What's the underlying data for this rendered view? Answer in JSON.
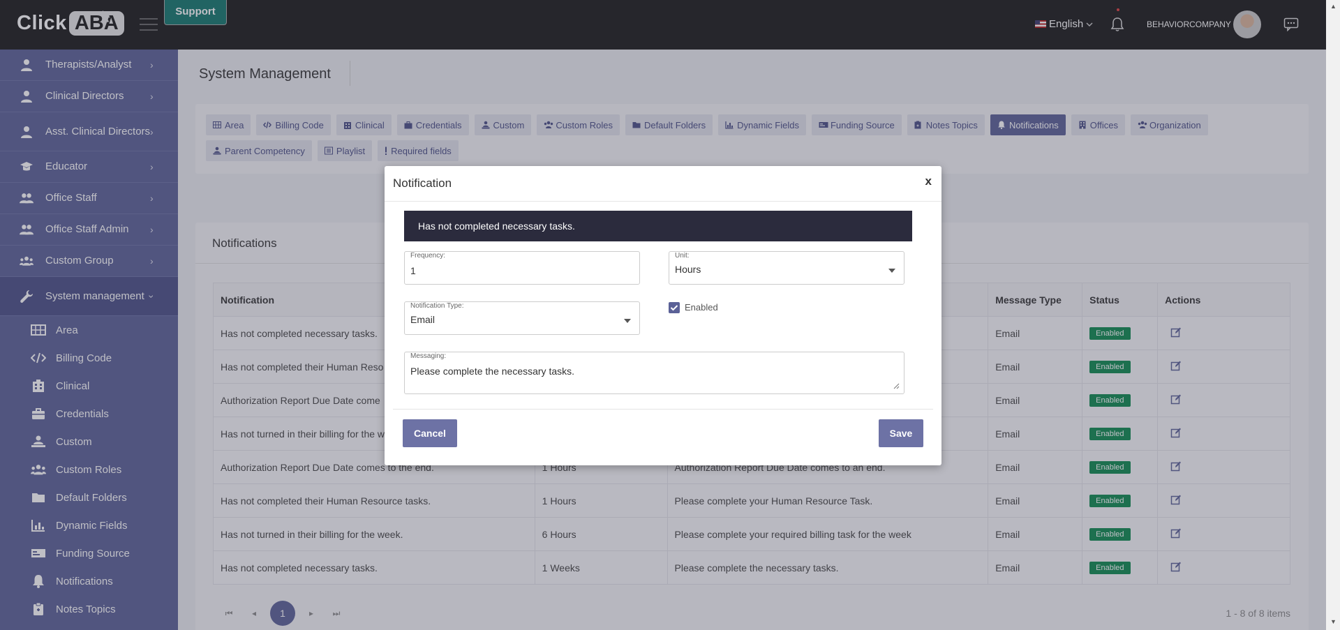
{
  "topbar": {
    "logo_click": "Click",
    "logo_aba": "ABA",
    "support_label": "Support",
    "language": "English",
    "company": "BEHAVIORCOMPANY"
  },
  "sidebar": {
    "items": [
      {
        "label": "Therapists/Analyst",
        "icon": "user-icon"
      },
      {
        "label": "Clinical Directors",
        "icon": "user-icon"
      },
      {
        "label": "Asst. Clinical Directors",
        "icon": "user-icon"
      },
      {
        "label": "Educator",
        "icon": "graduation-cap-icon"
      },
      {
        "label": "Office Staff",
        "icon": "users-icon"
      },
      {
        "label": "Office Staff Admin",
        "icon": "users-icon"
      },
      {
        "label": "Custom Group",
        "icon": "users-group-icon"
      },
      {
        "label": "System management",
        "icon": "wrench-icon"
      }
    ],
    "sub_items": [
      {
        "label": "Area",
        "icon": "map-icon"
      },
      {
        "label": "Billing Code",
        "icon": "code-icon"
      },
      {
        "label": "Clinical",
        "icon": "building-icon"
      },
      {
        "label": "Credentials",
        "icon": "briefcase-icon"
      },
      {
        "label": "Custom",
        "icon": "person-chalkboard-icon"
      },
      {
        "label": "Custom Roles",
        "icon": "users-group-icon"
      },
      {
        "label": "Default Folders",
        "icon": "folder-icon"
      },
      {
        "label": "Dynamic Fields",
        "icon": "chart-bar-icon"
      },
      {
        "label": "Funding Source",
        "icon": "money-bill-icon"
      },
      {
        "label": "Notifications",
        "icon": "bell-icon"
      },
      {
        "label": "Notes Topics",
        "icon": "clipboard-icon"
      }
    ]
  },
  "main": {
    "page_title": "System Management",
    "tabs_row1": [
      "Area",
      "Billing Code",
      "Clinical",
      "Credentials",
      "Custom",
      "Custom Roles",
      "Default Folders",
      "Dynamic Fields",
      "Funding Source",
      "Notes Topics",
      "Notifications",
      "Offices",
      "Organization"
    ],
    "tabs_row2": [
      "Parent Competency",
      "Playlist",
      "Required fields"
    ],
    "active_tab": "Notifications",
    "card_title": "Notifications",
    "columns": [
      "Notification",
      "",
      "",
      "Message Type",
      "Status",
      "Actions"
    ],
    "rows": [
      {
        "notification": "Has not completed necessary tasks.",
        "frequency": "",
        "message": "",
        "type": "Email",
        "status": "Enabled"
      },
      {
        "notification": "Has not completed their Human Reso",
        "frequency": "",
        "message": "",
        "type": "Email",
        "status": "Enabled"
      },
      {
        "notification": "Authorization Report Due Date come",
        "frequency": "",
        "message": "",
        "type": "Email",
        "status": "Enabled"
      },
      {
        "notification": "Has not turned in their billing for the w",
        "frequency": "",
        "message": "",
        "type": "Email",
        "status": "Enabled"
      },
      {
        "notification": "Authorization Report Due Date comes to the end.",
        "frequency": "1 Hours",
        "message": "Authorization Report Due Date comes to an end.",
        "type": "Email",
        "status": "Enabled"
      },
      {
        "notification": "Has not completed their Human Resource tasks.",
        "frequency": "1 Hours",
        "message": "Please complete your Human Resource Task.",
        "type": "Email",
        "status": "Enabled"
      },
      {
        "notification": "Has not turned in their billing for the week.",
        "frequency": "6 Hours",
        "message": "Please complete your required billing task for the week",
        "type": "Email",
        "status": "Enabled"
      },
      {
        "notification": "Has not completed necessary tasks.",
        "frequency": "1 Weeks",
        "message": "Please complete the necessary tasks.",
        "type": "Email",
        "status": "Enabled"
      }
    ],
    "pager": {
      "page": "1",
      "info": "1 - 8 of 8 items"
    }
  },
  "modal": {
    "title": "Notification",
    "close": "x",
    "banner": "Has not completed necessary tasks.",
    "frequency_label": "Frequency:",
    "frequency_value": "1",
    "unit_label": "Unit:",
    "unit_value": "Hours",
    "type_label": "Notification Type:",
    "type_value": "Email",
    "enabled_label": "Enabled",
    "enabled": true,
    "messaging_label": "Messaging:",
    "messaging_value": "Please complete the necessary tasks.",
    "cancel_label": "Cancel",
    "save_label": "Save"
  },
  "colors": {
    "accent": "#5b6197",
    "topbar": "#1c1c1c",
    "support": "#14786e",
    "enabled_badge": "#0e8a4f"
  }
}
